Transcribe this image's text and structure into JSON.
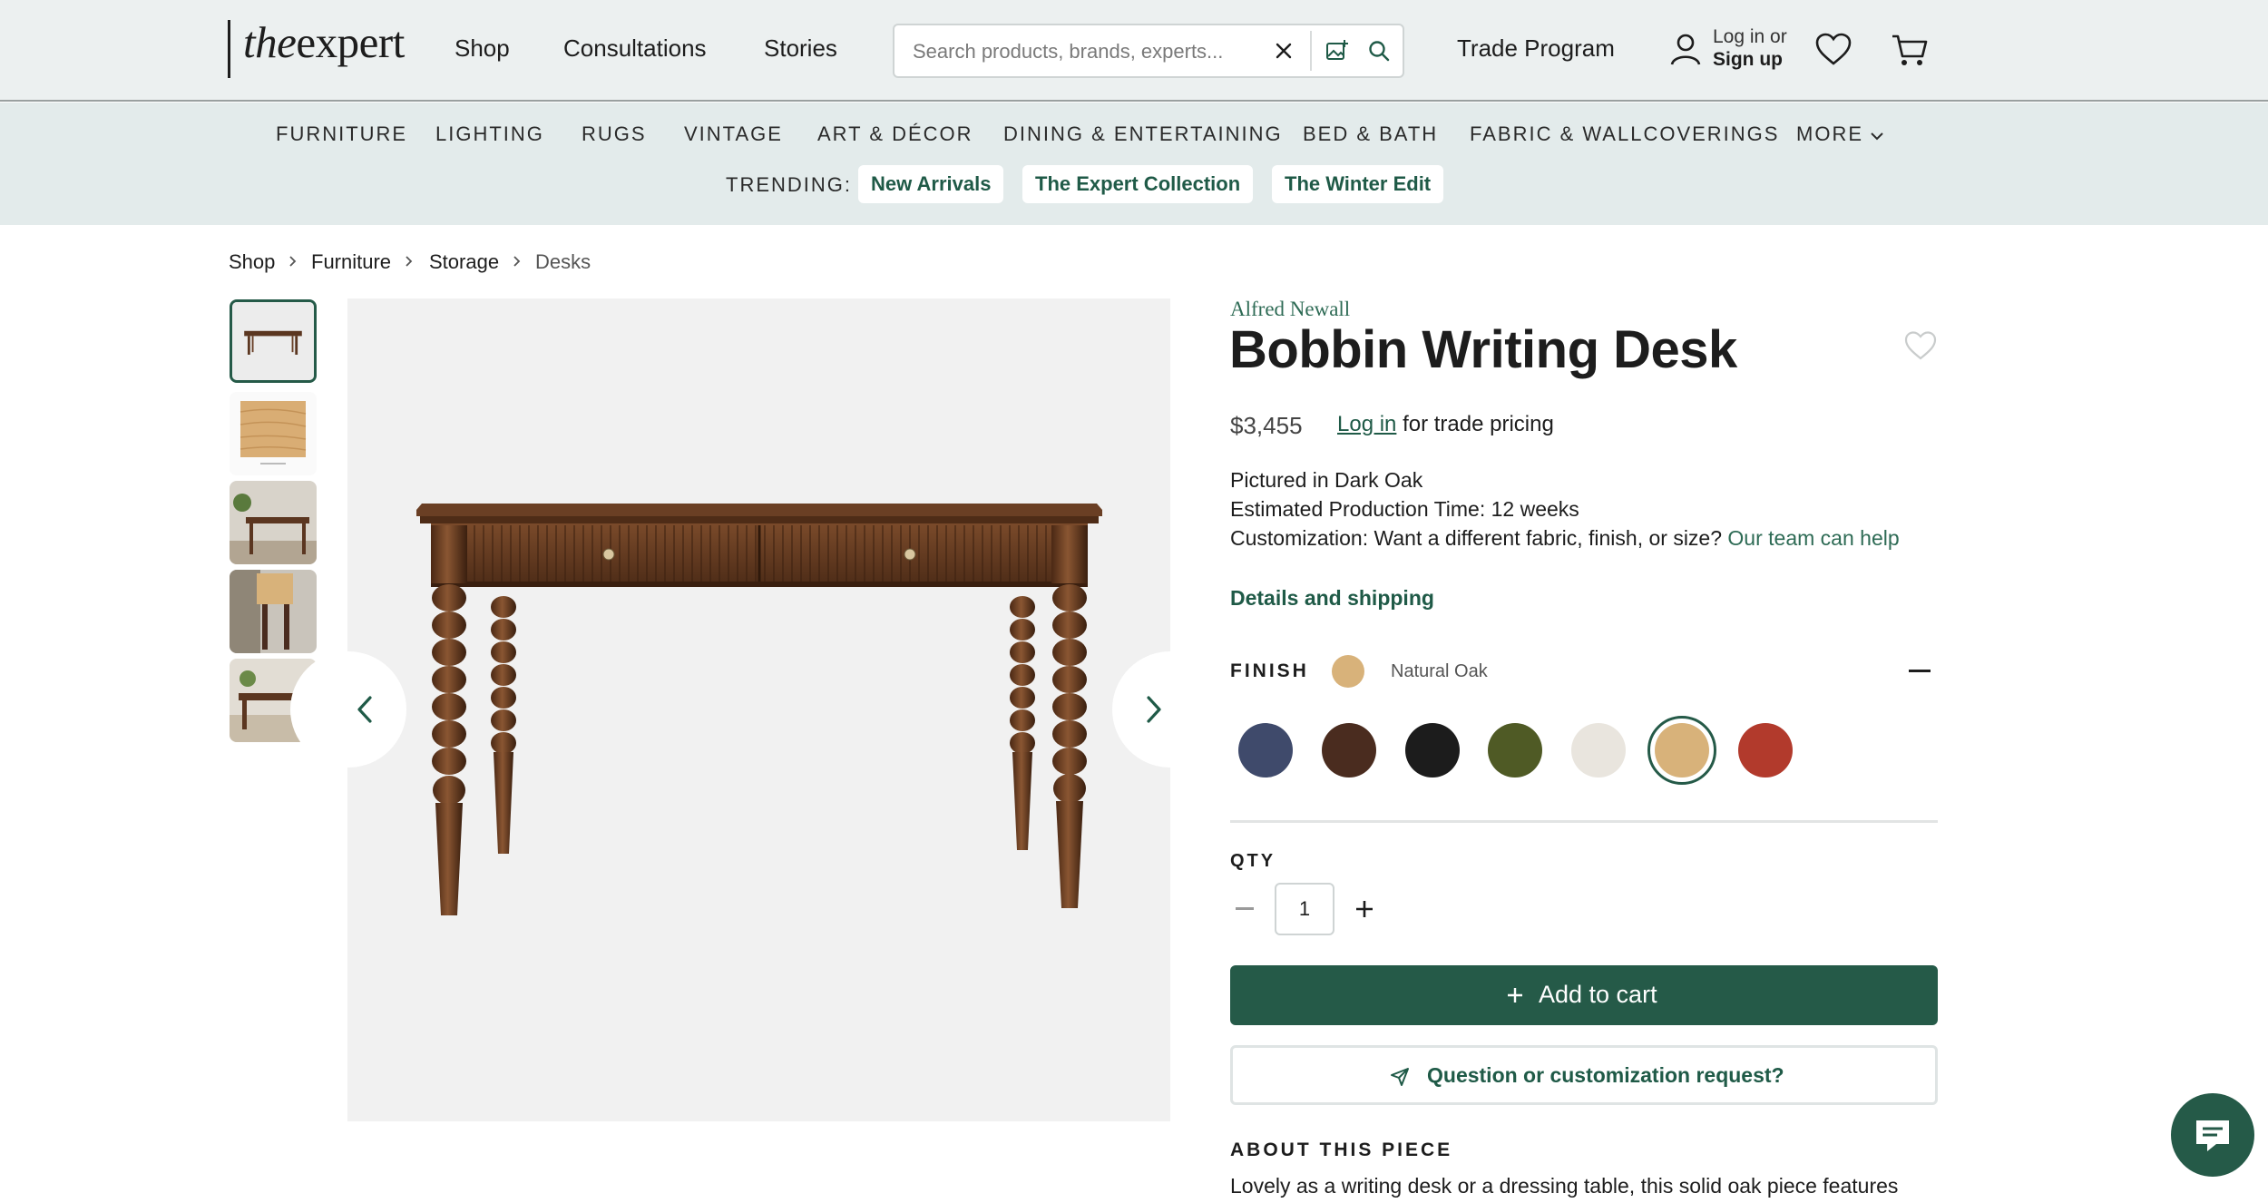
{
  "header": {
    "logo": {
      "the": "the",
      "expert": "expert"
    },
    "nav": [
      "Shop",
      "Consultations",
      "Stories"
    ],
    "search": {
      "placeholder": "Search products, brands, experts..."
    },
    "trade_program": "Trade Program",
    "account": {
      "line1": "Log in or",
      "line2": "Sign up"
    }
  },
  "categories": {
    "items": [
      "FURNITURE",
      "LIGHTING",
      "RUGS",
      "VINTAGE",
      "ART & DÉCOR",
      "DINING & ENTERTAINING",
      "BED & BATH",
      "FABRIC & WALLCOVERINGS",
      "MORE"
    ],
    "trending_label": "TRENDING:",
    "trending": [
      "New Arrivals",
      "The Expert Collection",
      "The Winter Edit"
    ]
  },
  "breadcrumb": [
    "Shop",
    "Furniture",
    "Storage",
    "Desks"
  ],
  "product": {
    "brand": "Alfred Newall",
    "title": "Bobbin Writing Desk",
    "price": "$3,455",
    "trade_login": "Log in",
    "trade_suffix": "for trade pricing",
    "pictured": "Pictured in Dark Oak",
    "production": "Estimated Production Time: 12 weeks",
    "customization": "Customization: Want a different fabric, finish, or size?",
    "customization_link": "Our team can help",
    "details_link": "Details and shipping",
    "finish_label": "FINISH",
    "finish_selected": "Natural Oak",
    "swatches": [
      {
        "name": "Navy",
        "color": "#3f4a6b"
      },
      {
        "name": "Dark Oak",
        "color": "#4a2c1f"
      },
      {
        "name": "Black",
        "color": "#1c1c1c"
      },
      {
        "name": "Olive",
        "color": "#4f5a25"
      },
      {
        "name": "White",
        "color": "#e9e5de"
      },
      {
        "name": "Natural Oak",
        "color": "#d8b27a",
        "selected": true
      },
      {
        "name": "Red",
        "color": "#b23a2c"
      }
    ],
    "qty_label": "QTY",
    "qty_value": "1",
    "add_to_cart": "Add to cart",
    "question": "Question or customization request?",
    "about_label": "ABOUT THIS PIECE",
    "about_text": "Lovely as a writing desk or a dressing table, this solid oak piece features"
  },
  "colors": {
    "brand_green": "#255a48",
    "link_green": "#2e6b55",
    "header_bg": "#ecf0f0",
    "category_bg": "#e3ebeb"
  }
}
